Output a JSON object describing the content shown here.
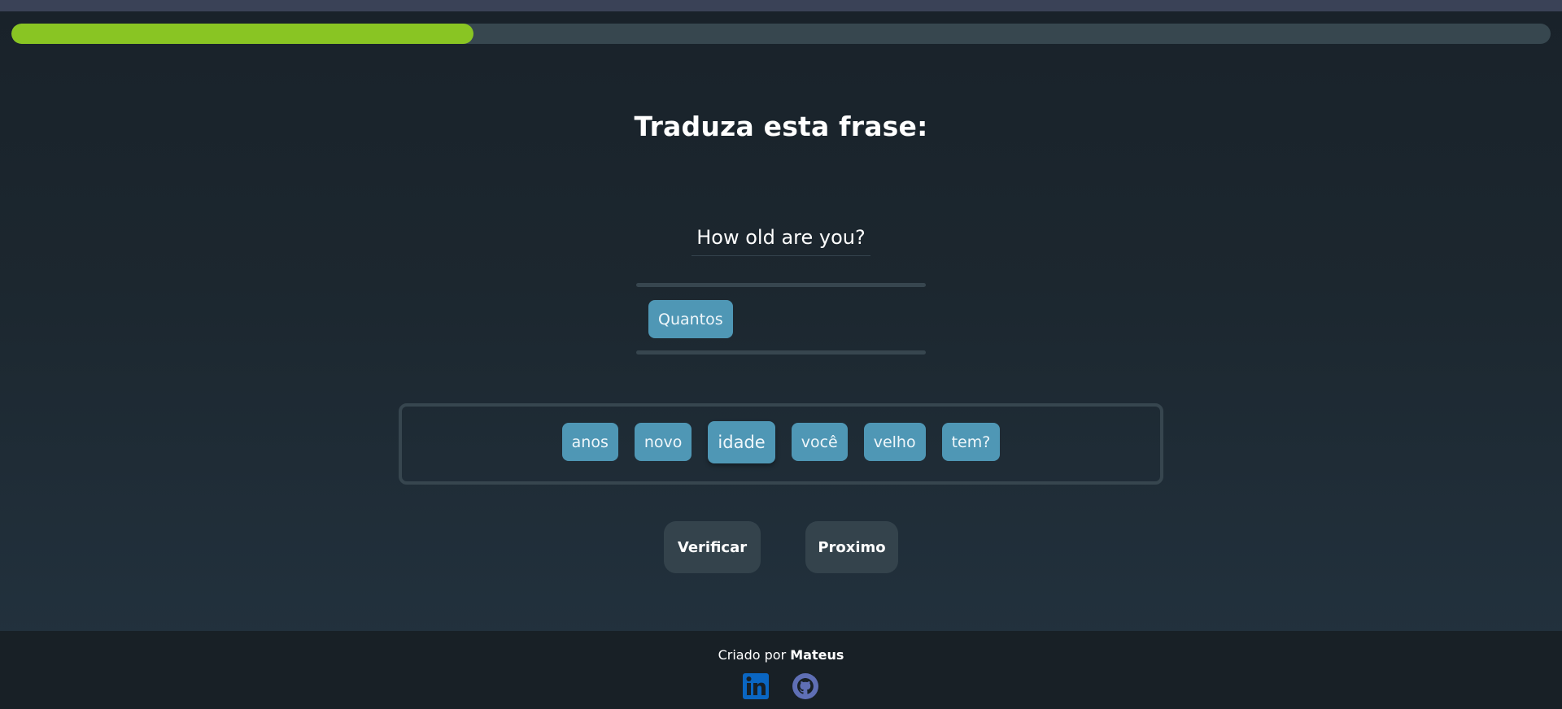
{
  "progress": {
    "fraction": 0.3
  },
  "exercise": {
    "title": "Traduza esta frase:",
    "sentence": "How old are you?"
  },
  "answer": {
    "words": [
      "Quantos"
    ]
  },
  "word_bank": {
    "words": [
      "anos",
      "novo",
      "idade",
      "você",
      "velho",
      "tem?"
    ]
  },
  "buttons": {
    "verify_label": "Verificar",
    "next_label": "Proximo"
  },
  "footer": {
    "credit_prefix": "Criado por",
    "author": "Mateus",
    "icons": [
      "linkedin-icon",
      "github-icon"
    ]
  },
  "colors": {
    "progress_fill": "#89c523",
    "chip": "#4f97b5",
    "linkedin": "#0a66c2",
    "github": "#5f6fb5"
  }
}
